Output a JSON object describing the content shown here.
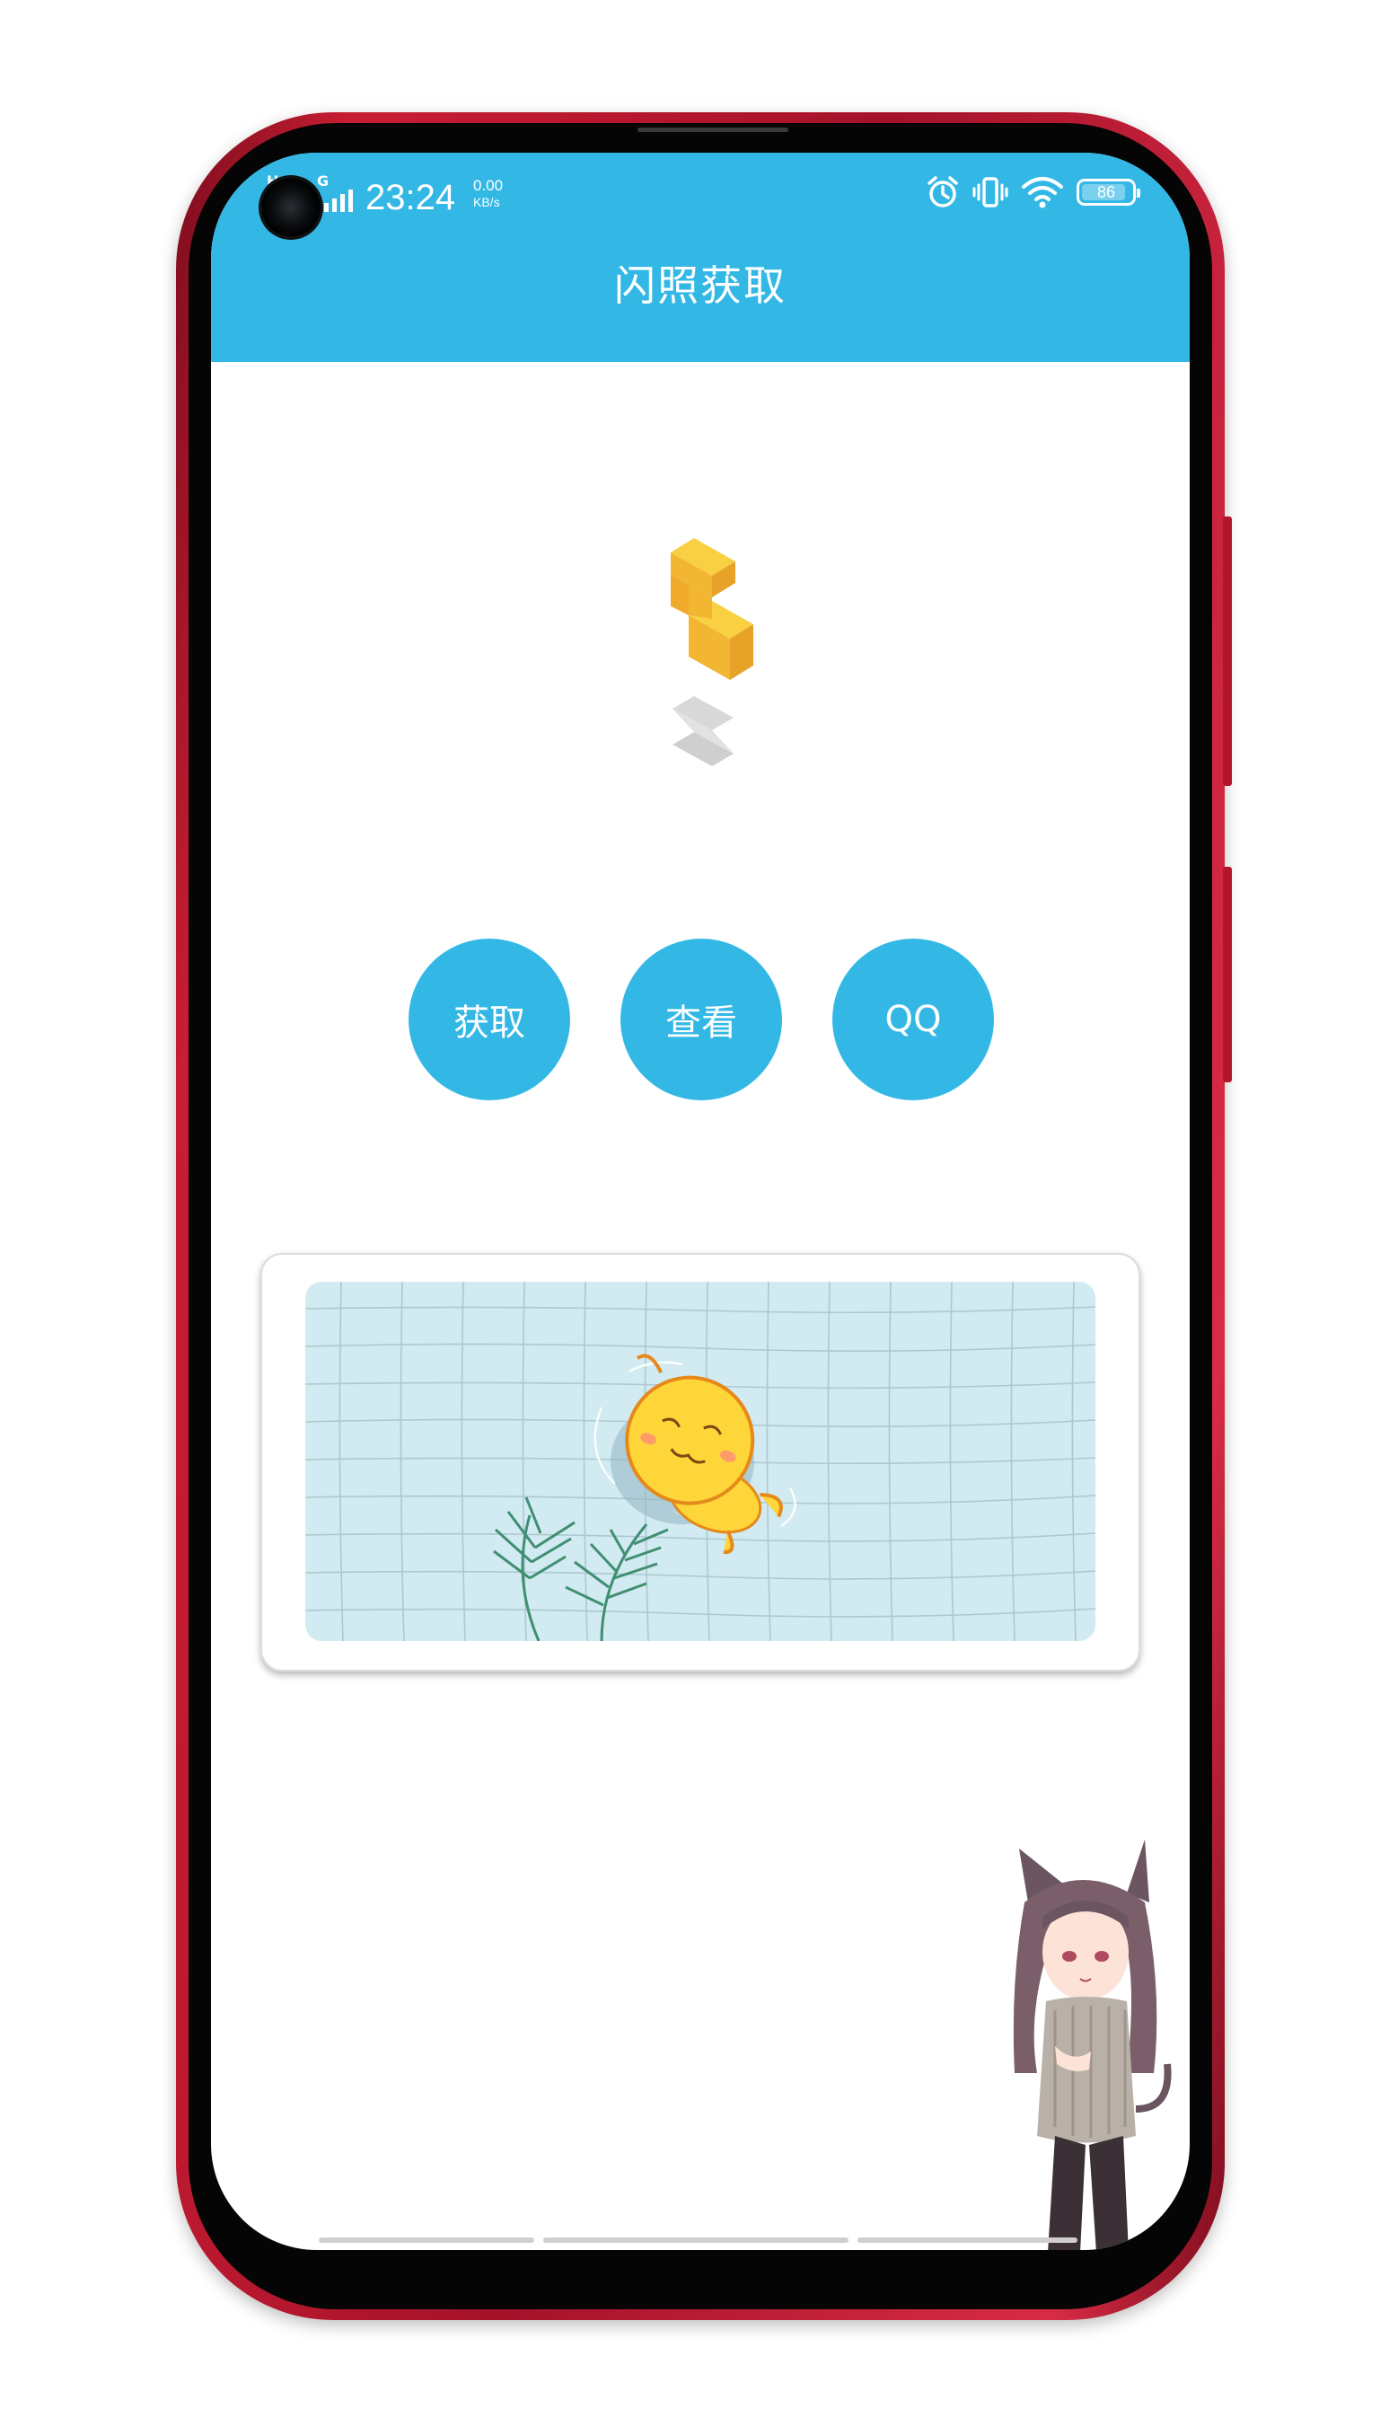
{
  "status_bar": {
    "network_label_left": "H",
    "network_label_right": "G",
    "time": "23:24",
    "net_speed_value": "0.00",
    "net_speed_unit": "KB/s",
    "icons": [
      "alarm-icon",
      "vibrate-icon",
      "wifi-icon",
      "battery-icon"
    ],
    "battery_level": "86"
  },
  "app_bar": {
    "title": "闪照获取"
  },
  "actions": {
    "get_label": "获取",
    "view_label": "查看",
    "qq_label": "QQ"
  },
  "colors": {
    "primary": "#33b8e6",
    "frame": "#c81d33",
    "banner_bg": "#d2eaf1"
  },
  "images": {
    "logo": "stacked-blocks-logo",
    "banner": "yellow-chick-floating-in-pool",
    "mascot": "anime-cat-girl-sticker"
  }
}
